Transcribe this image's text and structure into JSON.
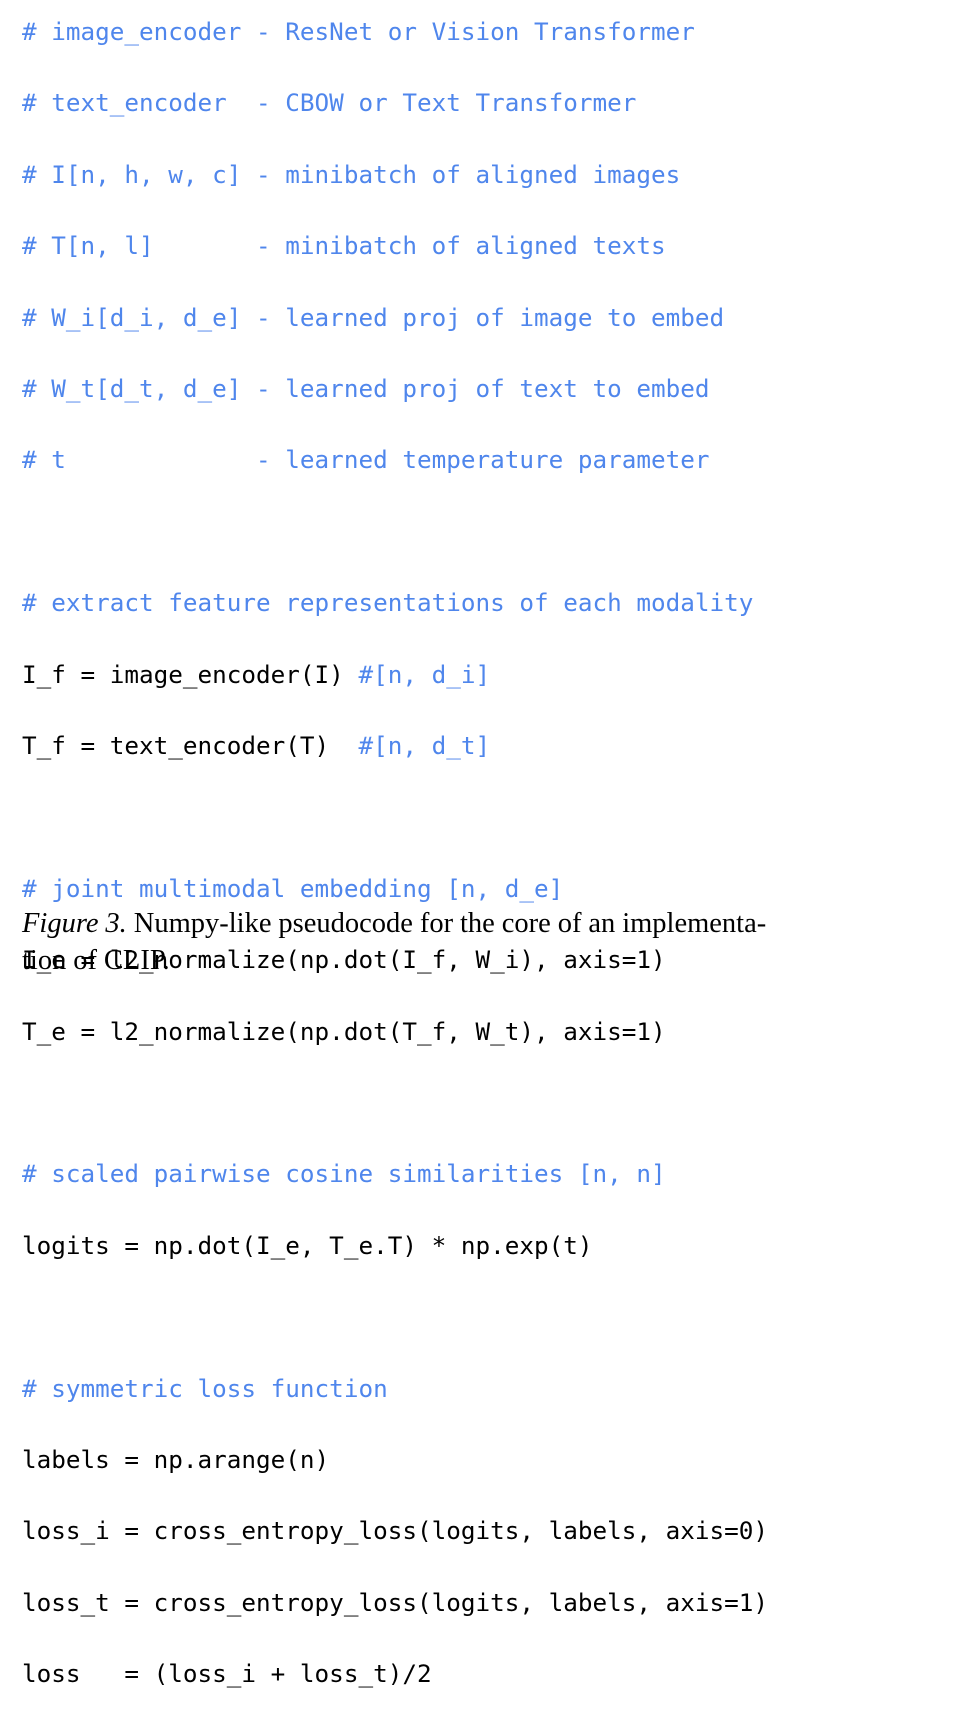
{
  "figure": {
    "language": "numpy-like pseudocode",
    "colors": {
      "comment": "#4f86ec",
      "code": "#000000",
      "background": "#ffffff",
      "caption": "#000000"
    },
    "code_lines": [
      {
        "id": "l01",
        "type": "comment",
        "text": "# image_encoder - ResNet or Vision Transformer"
      },
      {
        "id": "l02",
        "type": "comment",
        "text": "# text_encoder  - CBOW or Text Transformer"
      },
      {
        "id": "l03",
        "type": "comment",
        "text": "# I[n, h, w, c] - minibatch of aligned images"
      },
      {
        "id": "l04",
        "type": "comment",
        "text": "# T[n, l]       - minibatch of aligned texts"
      },
      {
        "id": "l05",
        "type": "comment",
        "text": "# W_i[d_i, d_e] - learned proj of image to embed"
      },
      {
        "id": "l06",
        "type": "comment",
        "text": "# W_t[d_t, d_e] - learned proj of text to embed"
      },
      {
        "id": "l07",
        "type": "comment",
        "text": "# t             - learned temperature parameter"
      },
      {
        "id": "l08",
        "type": "blank",
        "text": ""
      },
      {
        "id": "l09",
        "type": "comment",
        "text": "# extract feature representations of each modality"
      },
      {
        "id": "l10",
        "type": "mixed",
        "code": "I_f = image_encoder(I) ",
        "comment": "#[n, d_i]"
      },
      {
        "id": "l11",
        "type": "mixed",
        "code": "T_f = text_encoder(T)  ",
        "comment": "#[n, d_t]"
      },
      {
        "id": "l12",
        "type": "blank",
        "text": ""
      },
      {
        "id": "l13",
        "type": "comment",
        "text": "# joint multimodal embedding [n, d_e]"
      },
      {
        "id": "l14",
        "type": "code",
        "text": "I_e = l2_normalize(np.dot(I_f, W_i), axis=1)"
      },
      {
        "id": "l15",
        "type": "code",
        "text": "T_e = l2_normalize(np.dot(T_f, W_t), axis=1)"
      },
      {
        "id": "l16",
        "type": "blank",
        "text": ""
      },
      {
        "id": "l17",
        "type": "comment",
        "text": "# scaled pairwise cosine similarities [n, n]"
      },
      {
        "id": "l18",
        "type": "code",
        "text": "logits = np.dot(I_e, T_e.T) * np.exp(t)"
      },
      {
        "id": "l19",
        "type": "blank",
        "text": ""
      },
      {
        "id": "l20",
        "type": "comment",
        "text": "# symmetric loss function"
      },
      {
        "id": "l21",
        "type": "code",
        "text": "labels = np.arange(n)"
      },
      {
        "id": "l22",
        "type": "code",
        "text": "loss_i = cross_entropy_loss(logits, labels, axis=0)"
      },
      {
        "id": "l23",
        "type": "code",
        "text": "loss_t = cross_entropy_loss(logits, labels, axis=1)"
      },
      {
        "id": "l24",
        "type": "code",
        "text": "loss   = (loss_i + loss_t)/2"
      }
    ],
    "caption": {
      "label": "Figure 3.",
      "line1_rest": " Numpy-like pseudocode for the core of an implementa-",
      "line2": "tion of CLIP.",
      "full_text": "Figure 3. Numpy-like pseudocode for the core of an implementation of CLIP."
    }
  }
}
